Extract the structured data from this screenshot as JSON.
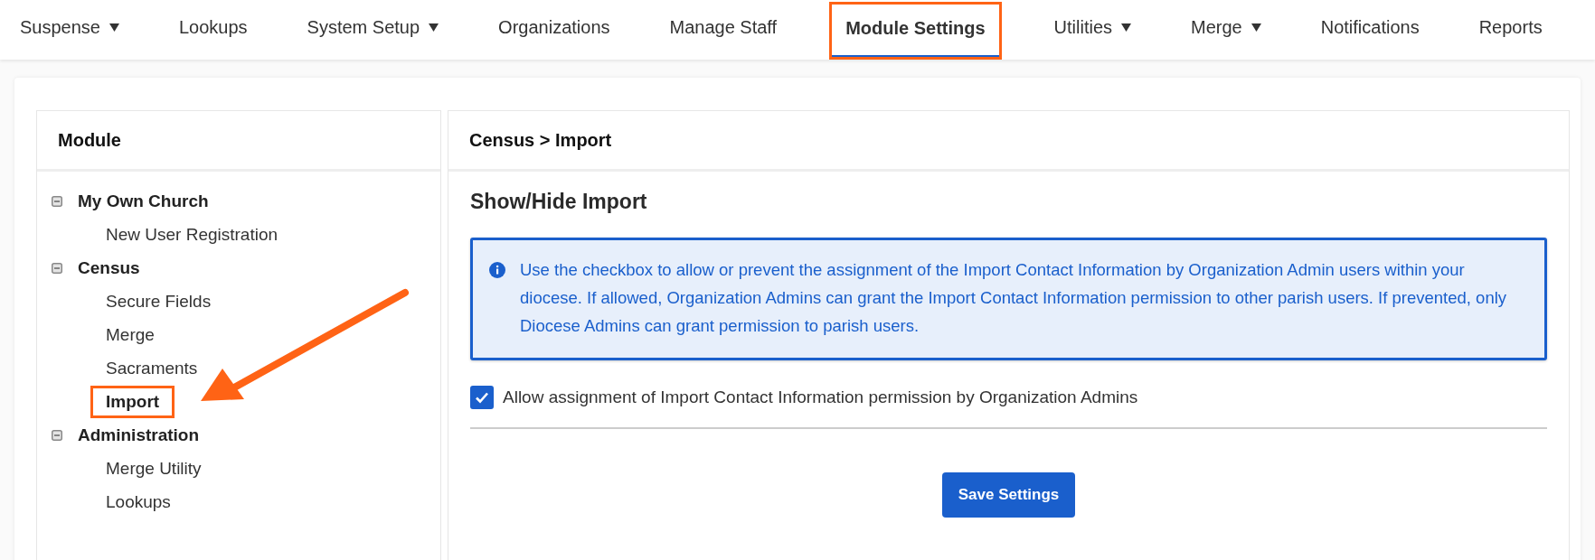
{
  "nav": [
    {
      "label": "Suspense",
      "dropdown": true,
      "selected": false,
      "highlighted": false
    },
    {
      "label": "Lookups",
      "dropdown": false,
      "selected": false,
      "highlighted": false
    },
    {
      "label": "System Setup",
      "dropdown": true,
      "selected": false,
      "highlighted": false
    },
    {
      "label": "Organizations",
      "dropdown": false,
      "selected": false,
      "highlighted": false
    },
    {
      "label": "Manage Staff",
      "dropdown": false,
      "selected": false,
      "highlighted": false
    },
    {
      "label": "Module Settings",
      "dropdown": false,
      "selected": true,
      "highlighted": true
    },
    {
      "label": "Utilities",
      "dropdown": true,
      "selected": false,
      "highlighted": false
    },
    {
      "label": "Merge",
      "dropdown": true,
      "selected": false,
      "highlighted": false
    },
    {
      "label": "Notifications",
      "dropdown": false,
      "selected": false,
      "highlighted": false
    },
    {
      "label": "Reports",
      "dropdown": false,
      "selected": false,
      "highlighted": false
    }
  ],
  "module_panel": {
    "title": "Module",
    "tree": [
      {
        "label": "My Own Church",
        "expanded": true,
        "children": [
          {
            "label": "New User Registration",
            "selected": false,
            "highlighted": false
          }
        ]
      },
      {
        "label": "Census",
        "expanded": true,
        "children": [
          {
            "label": "Secure Fields",
            "selected": false,
            "highlighted": false
          },
          {
            "label": "Merge",
            "selected": false,
            "highlighted": false
          },
          {
            "label": "Sacraments",
            "selected": false,
            "highlighted": false
          },
          {
            "label": "Import",
            "selected": true,
            "highlighted": true
          }
        ]
      },
      {
        "label": "Administration",
        "expanded": true,
        "children": [
          {
            "label": "Merge Utility",
            "selected": false,
            "highlighted": false
          },
          {
            "label": "Lookups",
            "selected": false,
            "highlighted": false
          }
        ]
      }
    ]
  },
  "settings_panel": {
    "breadcrumb": "Census > Import",
    "heading": "Show/Hide Import",
    "info": "Use the checkbox to allow or prevent the assignment of the Import Contact Information by Organization Admin users within your diocese. If allowed, Organization Admins can grant the Import Contact Information permission to other parish users. If prevented, only Diocese Admins can grant permission to parish users.",
    "checkbox": {
      "label": "Allow assignment of Import Contact Information permission by Organization Admins",
      "checked": true
    },
    "save_button": "Save Settings"
  }
}
